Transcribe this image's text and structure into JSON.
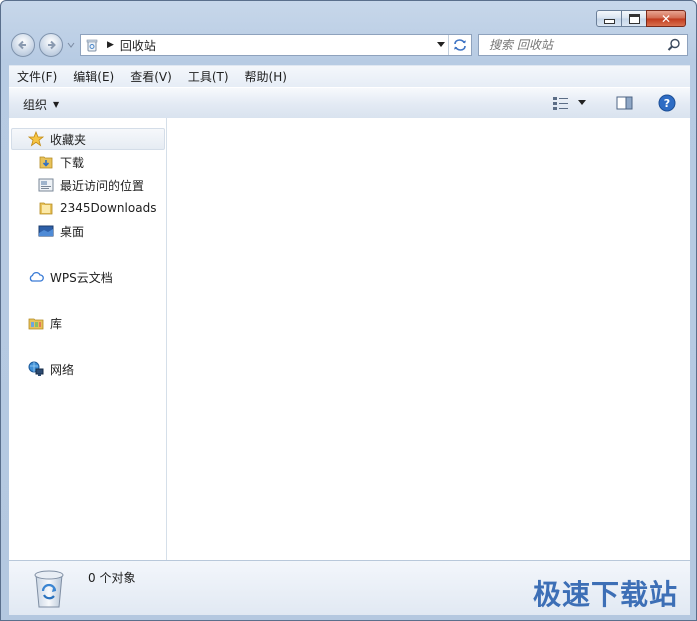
{
  "window": {
    "caption": {
      "minimize": "minimize",
      "maximize": "maximize",
      "close": "✕"
    }
  },
  "nav": {
    "address_location": "回收站",
    "search_placeholder": "搜索 回收站"
  },
  "menubar": {
    "items": [
      "文件(F)",
      "编辑(E)",
      "查看(V)",
      "工具(T)",
      "帮助(H)"
    ]
  },
  "toolbar": {
    "organize_label": "组织"
  },
  "sidebar": {
    "favorites": {
      "label": "收藏夹",
      "items": [
        {
          "label": "下载",
          "icon": "download-folder-icon"
        },
        {
          "label": "最近访问的位置",
          "icon": "recent-places-icon"
        },
        {
          "label": "2345Downloads",
          "icon": "folder-icon"
        },
        {
          "label": "桌面",
          "icon": "desktop-icon"
        }
      ]
    },
    "wps": {
      "label": "WPS云文档",
      "icon": "cloud-icon"
    },
    "libraries": {
      "label": "库",
      "icon": "library-icon"
    },
    "network": {
      "label": "网络",
      "icon": "network-icon"
    }
  },
  "details": {
    "count_text": "0 个对象"
  },
  "watermark": "极速下载站",
  "colors": {
    "accent": "#3d6fb6",
    "selection": "#e6ecf3",
    "chrome": "#b7cbe3"
  }
}
